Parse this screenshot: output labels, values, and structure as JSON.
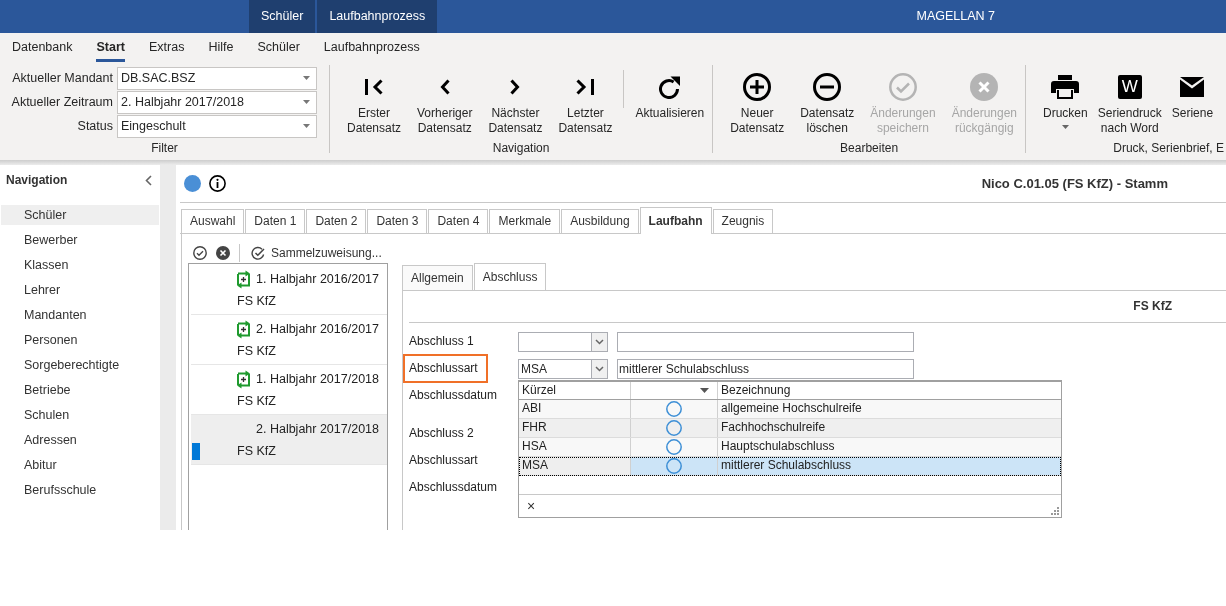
{
  "title_bar": {
    "context_tabs": [
      {
        "label": "Schüler"
      },
      {
        "label": "Laufbahnprozess"
      }
    ],
    "title": "MAGELLAN 7"
  },
  "ribbon": {
    "tabs": [
      {
        "label": "Datenbank",
        "selected": false
      },
      {
        "label": "Start",
        "selected": true
      },
      {
        "label": "Extras",
        "selected": false
      },
      {
        "label": "Hilfe",
        "selected": false
      },
      {
        "label": "Schüler",
        "selected": false
      },
      {
        "label": "Laufbahnprozess",
        "selected": false
      }
    ],
    "groups": [
      {
        "kind": "filter",
        "label": "Filter",
        "fields": [
          {
            "label": "Aktueller Mandant",
            "value": "DB.SAC.BSZ"
          },
          {
            "label": "Aktueller Zeitraum",
            "value": "2. Halbjahr 2017/2018"
          },
          {
            "label": "Status",
            "value": "Eingeschult"
          }
        ]
      },
      {
        "kind": "buttons",
        "label": "Navigation",
        "sets": [
          {
            "buttons": [
              {
                "kind": "first",
                "lines": [
                  "Erster",
                  "Datensatz"
                ],
                "disabled": false,
                "menu": false
              },
              {
                "kind": "previous",
                "lines": [
                  "Vorheriger",
                  "Datensatz"
                ],
                "disabled": false,
                "menu": false
              },
              {
                "kind": "next",
                "lines": [
                  "Nächster",
                  "Datensatz"
                ],
                "disabled": false,
                "menu": false
              },
              {
                "kind": "last",
                "lines": [
                  "Letzter",
                  "Datensatz"
                ],
                "disabled": false,
                "menu": false
              }
            ]
          },
          {
            "buttons": [
              {
                "kind": "refresh",
                "lines": [
                  "Aktualisieren"
                ],
                "disabled": false,
                "menu": false
              }
            ]
          }
        ]
      },
      {
        "kind": "buttons",
        "label": "Bearbeiten",
        "sets": [
          {
            "buttons": [
              {
                "kind": "new",
                "lines": [
                  "Neuer",
                  "Datensatz"
                ],
                "disabled": false,
                "menu": false
              },
              {
                "kind": "delete",
                "lines": [
                  "Datensatz",
                  "löschen"
                ],
                "disabled": false,
                "menu": false
              },
              {
                "kind": "save",
                "lines": [
                  "Änderungen",
                  "speichern"
                ],
                "disabled": true,
                "menu": false
              },
              {
                "kind": "undo",
                "lines": [
                  "Änderungen",
                  "rückgängig"
                ],
                "disabled": true,
                "menu": false
              }
            ]
          }
        ]
      },
      {
        "kind": "buttons",
        "label": "Druck, Serienbrief, E",
        "sets": [
          {
            "buttons": [
              {
                "kind": "print",
                "lines": [
                  "Drucken"
                ],
                "disabled": false,
                "menu": true
              },
              {
                "kind": "word",
                "icon_letter": "W",
                "lines": [
                  "Seriendruck",
                  "nach Word"
                ],
                "disabled": false,
                "menu": false
              },
              {
                "kind": "mail",
                "lines": [
                  "Seriene"
                ],
                "disabled": false,
                "menu": false
              }
            ]
          }
        ]
      }
    ]
  },
  "navigation": {
    "title": "Navigation",
    "items": [
      {
        "label": "Schüler",
        "selected": true
      },
      {
        "label": "Bewerber",
        "selected": false
      },
      {
        "label": "Klassen",
        "selected": false
      },
      {
        "label": "Lehrer",
        "selected": false
      },
      {
        "label": "Mandanten",
        "selected": false
      },
      {
        "label": "Personen",
        "selected": false
      },
      {
        "label": "Sorgeberechtigte",
        "selected": false
      },
      {
        "label": "Betriebe",
        "selected": false
      },
      {
        "label": "Schulen",
        "selected": false
      },
      {
        "label": "Adressen",
        "selected": false
      },
      {
        "label": "Abitur",
        "selected": false
      },
      {
        "label": "Berufsschule",
        "selected": false
      }
    ]
  },
  "record": {
    "title": "Nico C.01.05 (FS KfZ) - Stamm",
    "tabs": [
      {
        "label": "Auswahl",
        "selected": false
      },
      {
        "label": "Daten 1",
        "selected": false
      },
      {
        "label": "Daten 2",
        "selected": false
      },
      {
        "label": "Daten 3",
        "selected": false
      },
      {
        "label": "Daten 4",
        "selected": false
      },
      {
        "label": "Merkmale",
        "selected": false
      },
      {
        "label": "Ausbildung",
        "selected": false
      },
      {
        "label": "Laufbahn",
        "selected": true
      },
      {
        "label": "Zeugnis",
        "selected": false
      }
    ],
    "toolbar": {
      "action": "Sammelzuweisung..."
    },
    "periods": [
      {
        "title": "1. Halbjahr 2016/2017",
        "subtitle": "FS KfZ",
        "marked": true,
        "selected": false
      },
      {
        "title": "2. Halbjahr 2016/2017",
        "subtitle": "FS KfZ",
        "marked": true,
        "selected": false
      },
      {
        "title": "1. Halbjahr 2017/2018",
        "subtitle": "FS KfZ",
        "marked": true,
        "selected": false
      },
      {
        "title": "2. Halbjahr 2017/2018",
        "subtitle": "FS KfZ",
        "marked": false,
        "selected": true
      }
    ],
    "subtabs": [
      {
        "label": "Allgemein",
        "selected": false
      },
      {
        "label": "Abschluss",
        "selected": true
      }
    ],
    "section_title": "FS KfZ",
    "form": {
      "sections": [
        {
          "rows": [
            {
              "label": "Abschluss 1",
              "kind": "combo",
              "highlighted": false
            },
            {
              "label": "Abschlussart",
              "kind": "combo",
              "highlighted": true,
              "value": "MSA",
              "text": "mittlerer Schulabschluss",
              "dropdown": {
                "columns": [
                  {
                    "label": "Kürzel",
                    "filter": false
                  },
                  {
                    "filter": true
                  },
                  {
                    "label": "Bezeichnung",
                    "filter": false
                  }
                ],
                "rows": [
                  {
                    "code": "ABI",
                    "checked": false,
                    "name": "allgemeine Hochschulreife",
                    "selected": false
                  },
                  {
                    "code": "FHR",
                    "checked": false,
                    "name": "Fachhochschulreife",
                    "selected": false
                  },
                  {
                    "code": "HSA",
                    "checked": false,
                    "name": "Hauptschulabschluss",
                    "selected": false
                  },
                  {
                    "code": "MSA",
                    "checked": false,
                    "name": "mittlerer Schulabschluss",
                    "selected": true
                  }
                ],
                "clear": "×"
              }
            },
            {
              "label": "Abschlussdatum",
              "kind": "label",
              "highlighted": false
            }
          ]
        },
        {
          "rows": [
            {
              "label": "Abschluss 2",
              "kind": "label",
              "highlighted": false
            },
            {
              "label": "Abschlussart",
              "kind": "label",
              "highlighted": false
            },
            {
              "label": "Abschlussdatum",
              "kind": "label",
              "highlighted": false
            }
          ]
        }
      ]
    }
  }
}
